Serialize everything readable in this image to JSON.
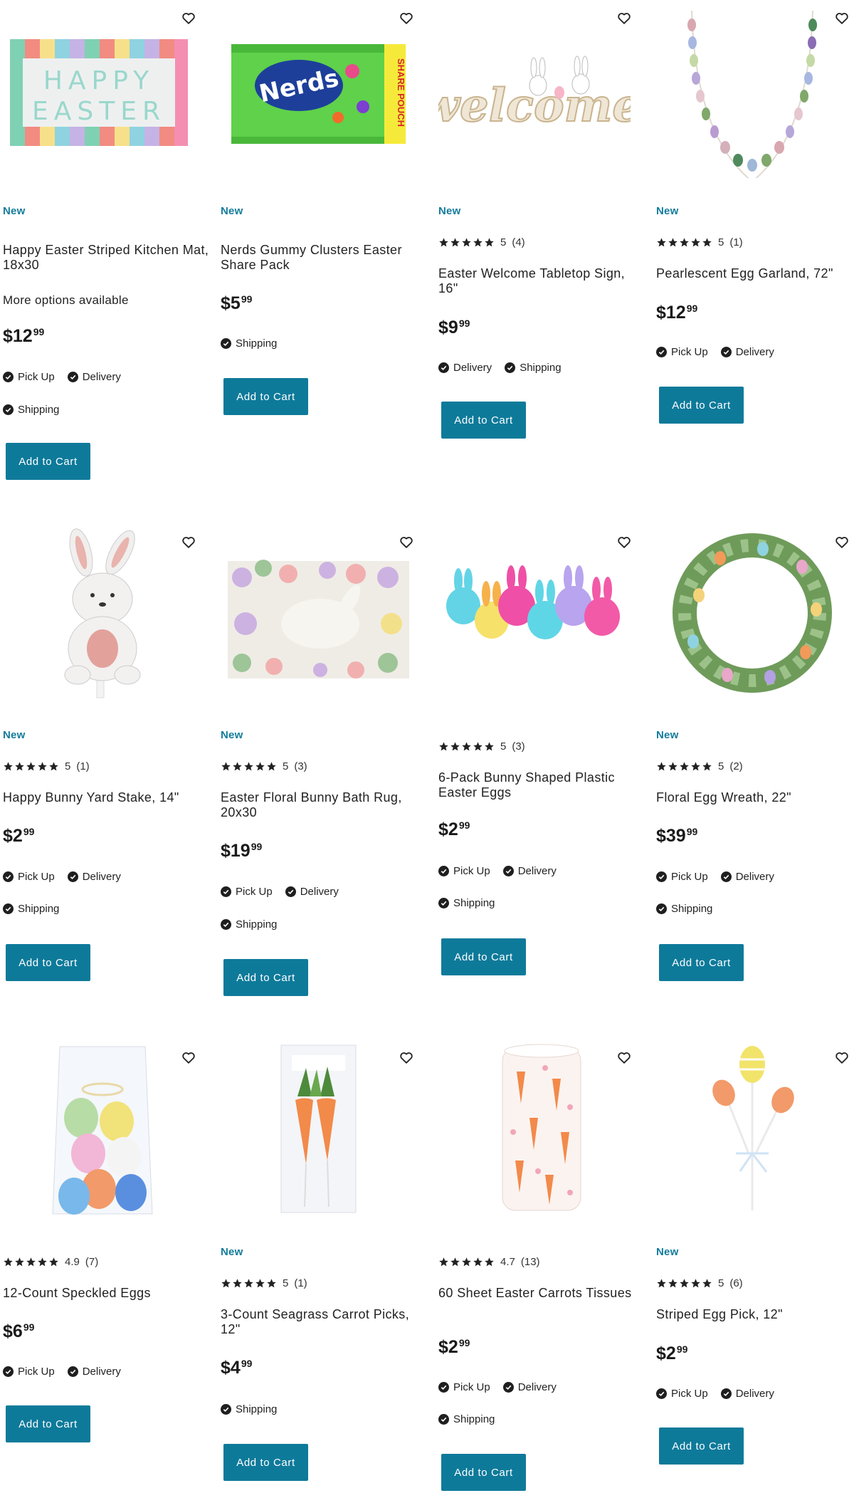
{
  "products": [
    {
      "name": "Happy Easter Striped Kitchen Mat, 18x30",
      "new_label": "New",
      "rating": "",
      "reviews": "",
      "more": "More options available",
      "price_dollars": "$12",
      "price_cents": "99",
      "fulfil_row1": [
        "Pick Up",
        "Delivery"
      ],
      "fulfil_row2": [
        "Shipping"
      ],
      "button": "Add to Cart",
      "image_icon": "striped-mat-image"
    },
    {
      "name": "Nerds Gummy Clusters Easter Share Pack",
      "new_label": "New",
      "rating": "",
      "reviews": "",
      "more": "",
      "price_dollars": "$5",
      "price_cents": "99",
      "fulfil_row1": [
        "Shipping"
      ],
      "fulfil_row2": [],
      "button": "Add to Cart",
      "image_icon": "candy-pouch-image"
    },
    {
      "name": "Easter Welcome Tabletop Sign, 16\"",
      "new_label": "New",
      "rating": "5",
      "reviews": "(4)",
      "more": "",
      "price_dollars": "$9",
      "price_cents": "99",
      "fulfil_row1": [
        "Delivery",
        "Shipping"
      ],
      "fulfil_row2": [],
      "button": "Add to Cart",
      "image_icon": "welcome-sign-image"
    },
    {
      "name": "Pearlescent Egg Garland, 72\"",
      "new_label": "New",
      "rating": "5",
      "reviews": "(1)",
      "more": "",
      "price_dollars": "$12",
      "price_cents": "99",
      "fulfil_row1": [
        "Pick Up",
        "Delivery"
      ],
      "fulfil_row2": [],
      "button": "Add to Cart",
      "image_icon": "egg-garland-image"
    },
    {
      "name": "Happy Bunny Yard Stake, 14\"",
      "new_label": "New",
      "rating": "5",
      "reviews": "(1)",
      "more": "",
      "price_dollars": "$2",
      "price_cents": "99",
      "fulfil_row1": [
        "Pick Up",
        "Delivery"
      ],
      "fulfil_row2": [
        "Shipping"
      ],
      "button": "Add to Cart",
      "image_icon": "bunny-stake-image"
    },
    {
      "name": "Easter Floral Bunny Bath Rug, 20x30",
      "new_label": "New",
      "rating": "5",
      "reviews": "(3)",
      "more": "",
      "price_dollars": "$19",
      "price_cents": "99",
      "fulfil_row1": [
        "Pick Up",
        "Delivery"
      ],
      "fulfil_row2": [
        "Shipping"
      ],
      "button": "Add to Cart",
      "image_icon": "bath-rug-image"
    },
    {
      "name": "6-Pack Bunny Shaped Plastic Easter Eggs",
      "new_label": "",
      "rating": "5",
      "reviews": "(3)",
      "more": "",
      "price_dollars": "$2",
      "price_cents": "99",
      "fulfil_row1": [
        "Pick Up",
        "Delivery"
      ],
      "fulfil_row2": [
        "Shipping"
      ],
      "button": "Add to Cart",
      "image_icon": "bunny-eggs-image"
    },
    {
      "name": "Floral Egg Wreath, 22\"",
      "new_label": "New",
      "rating": "5",
      "reviews": "(2)",
      "more": "",
      "price_dollars": "$39",
      "price_cents": "99",
      "fulfil_row1": [
        "Pick Up",
        "Delivery"
      ],
      "fulfil_row2": [
        "Shipping"
      ],
      "button": "Add to Cart",
      "image_icon": "egg-wreath-image"
    },
    {
      "name": "12-Count Speckled Eggs",
      "new_label": "",
      "rating": "4.9",
      "reviews": "(7)",
      "more": "",
      "price_dollars": "$6",
      "price_cents": "99",
      "fulfil_row1": [
        "Pick Up",
        "Delivery"
      ],
      "fulfil_row2": [],
      "button": "Add to Cart",
      "image_icon": "speckled-eggs-image"
    },
    {
      "name": "3-Count Seagrass Carrot Picks, 12\"",
      "new_label": "New",
      "rating": "5",
      "reviews": "(1)",
      "more": "",
      "price_dollars": "$4",
      "price_cents": "99",
      "fulfil_row1": [
        "Shipping"
      ],
      "fulfil_row2": [],
      "button": "Add to Cart",
      "image_icon": "carrot-picks-image"
    },
    {
      "name": "60 Sheet Easter Carrots Tissues",
      "new_label": "",
      "rating": "4.7",
      "reviews": "(13)",
      "more": "",
      "price_dollars": "$2",
      "price_cents": "99",
      "fulfil_row1": [
        "Pick Up",
        "Delivery"
      ],
      "fulfil_row2": [
        "Shipping"
      ],
      "button": "Add to Cart",
      "image_icon": "tissues-image"
    },
    {
      "name": "Striped Egg Pick, 12\"",
      "new_label": "New",
      "rating": "5",
      "reviews": "(6)",
      "more": "",
      "price_dollars": "$2",
      "price_cents": "99",
      "fulfil_row1": [
        "Pick Up",
        "Delivery"
      ],
      "fulfil_row2": [],
      "button": "Add to Cart",
      "image_icon": "egg-pick-image"
    }
  ],
  "colors": {
    "accent": "#0e7a9a",
    "new_label": "#137c9b",
    "text": "#222222"
  },
  "icons": {
    "wishlist": "heart-outline-icon",
    "star": "star-icon",
    "check": "check-circle-icon"
  }
}
